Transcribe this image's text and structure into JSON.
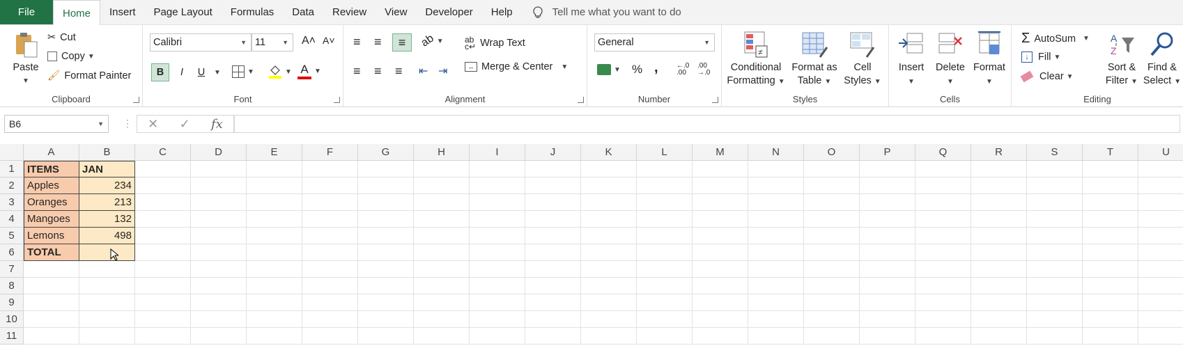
{
  "menu": {
    "file": "File",
    "tabs": [
      "Home",
      "Insert",
      "Page Layout",
      "Formulas",
      "Data",
      "Review",
      "View",
      "Developer",
      "Help"
    ],
    "tell_me": "Tell me what you want to do"
  },
  "clipboard": {
    "paste": "Paste",
    "cut": "Cut",
    "copy": "Copy",
    "format_painter": "Format Painter",
    "label": "Clipboard"
  },
  "font": {
    "name": "Calibri",
    "size": "11",
    "bold": "B",
    "italic": "I",
    "underline": "U",
    "label": "Font"
  },
  "alignment": {
    "wrap_text": "Wrap Text",
    "merge_center": "Merge & Center",
    "label": "Alignment"
  },
  "number": {
    "format": "General",
    "percent": "%",
    "comma": ",",
    "label": "Number"
  },
  "styles": {
    "conditional_1": "Conditional",
    "conditional_2": "Formatting",
    "format_table_1": "Format as",
    "format_table_2": "Table",
    "cell_styles_1": "Cell",
    "cell_styles_2": "Styles",
    "label": "Styles"
  },
  "cells": {
    "insert": "Insert",
    "delete": "Delete",
    "format": "Format",
    "label": "Cells"
  },
  "editing": {
    "autosum": "AutoSum",
    "fill": "Fill",
    "clear": "Clear",
    "sort_1": "Sort &",
    "sort_2": "Filter",
    "find_1": "Find &",
    "find_2": "Select",
    "label": "Editing"
  },
  "formula_bar": {
    "name_box": "B6",
    "fx": "fx",
    "value": ""
  },
  "columns": [
    "A",
    "B",
    "C",
    "D",
    "E",
    "F",
    "G",
    "H",
    "I",
    "J",
    "K",
    "L",
    "M",
    "N",
    "O",
    "P",
    "Q",
    "R",
    "S",
    "T",
    "U"
  ],
  "rows": [
    "1",
    "2",
    "3",
    "4",
    "5",
    "6",
    "7",
    "8",
    "9",
    "10",
    "11"
  ],
  "sheet": {
    "header_items": "ITEMS",
    "header_jan": "JAN",
    "items": [
      "Apples",
      "Oranges",
      "Mangoes",
      "Lemons"
    ],
    "values": [
      "234",
      "213",
      "132",
      "498"
    ],
    "total": "TOTAL",
    "total_value": ""
  },
  "colors": {
    "accent": "#217346",
    "items_fill": "#f8cbad",
    "values_fill": "#fde9c5"
  }
}
